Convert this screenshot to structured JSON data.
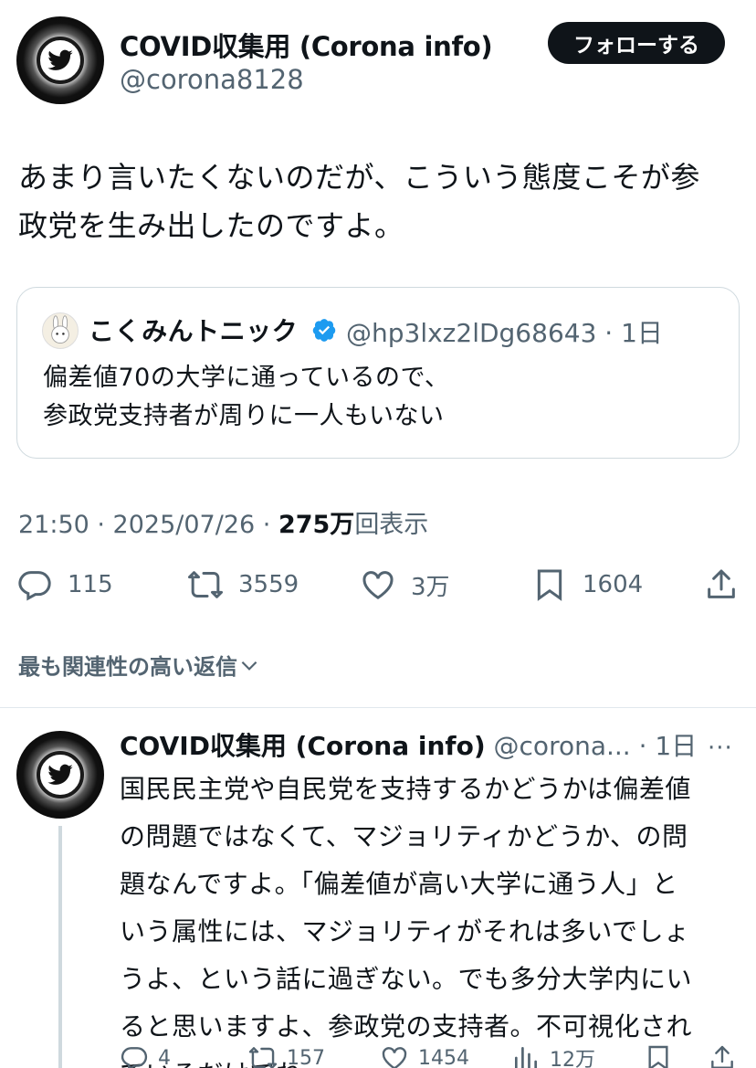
{
  "tweet": {
    "author_name": "COVID収集用 (Corona info)",
    "author_handle": "@corona8128",
    "follow_label": "フォローする",
    "text_line1": "あまり言いたくないのだが、こういう態度こそが参",
    "text_line2": "政党を生み出したのですよ。",
    "quote": {
      "name": "こくみんトニック",
      "handle_time": "@hp3lxz2lDg68643 · 1日",
      "text_line1": "偏差値70の大学に通っているので、",
      "text_line2": "参政党支持者が周りに一人もいない"
    },
    "meta_time": "21:50 · 2025/07/26 · ",
    "meta_views_count": "275万",
    "meta_views_label": "回表示",
    "actions": {
      "replies": "115",
      "retweets": "3559",
      "likes": "3万",
      "bookmarks": "1604"
    }
  },
  "replies_filter_label": "最も関連性の高い返信",
  "reply": {
    "author_name": "COVID収集用 (Corona info)",
    "author_handle_time": " @corona... · 1日",
    "more_label": "···",
    "lines": [
      "国民民主党や自民党を支持するかどうかは偏差値",
      "の問題ではなくて、マジョリティかどうか、の問",
      "題なんですよ。「偏差値が高い大学に通う人」と",
      "いう属性には、マジョリティがそれは多いでしょ",
      "うよ、という話に過ぎない。でも多分大学内にい",
      "ると思いますよ、参政党の支持者。不可視化され",
      "ているだけでね。"
    ],
    "actions": {
      "replies": "4",
      "retweets": "157",
      "likes": "1454",
      "views": "12万"
    }
  },
  "colors": {
    "text": "#0f1419",
    "secondary": "#536471",
    "verified": "#1d9bf0",
    "border": "#cfd9de"
  },
  "icons": [
    "twitter-bird-icon",
    "verified-badge-icon",
    "reply-icon",
    "retweet-icon",
    "like-icon",
    "bookmark-icon",
    "share-icon",
    "views-icon",
    "chevron-down-icon",
    "more-icon"
  ]
}
